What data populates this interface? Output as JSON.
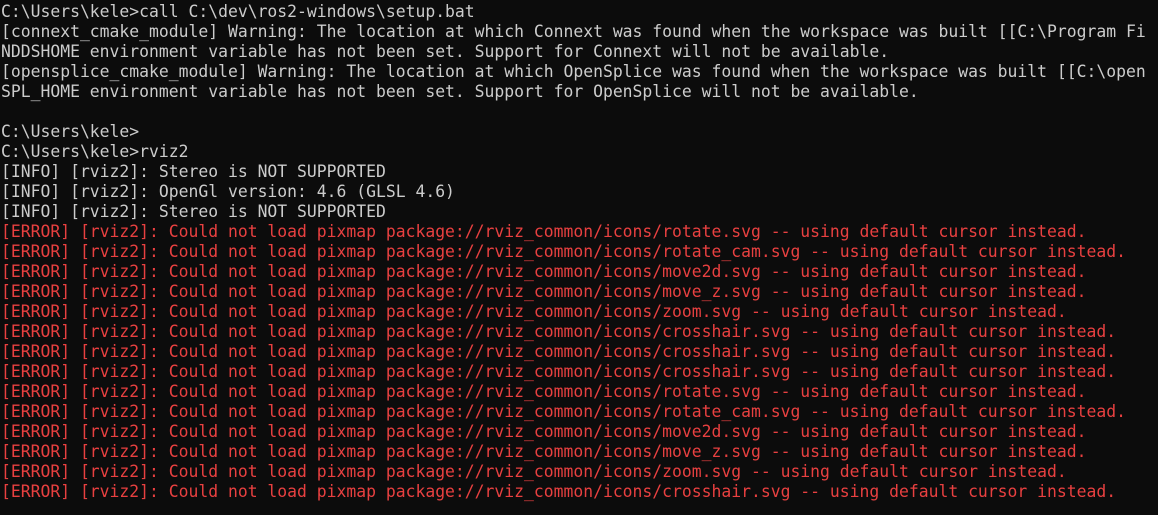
{
  "terminal": {
    "colors": {
      "background": "#0c0c0c",
      "text": "#cccccc",
      "error": "#e84040"
    },
    "lines": [
      {
        "text": "C:\\Users\\kele>call C:\\dev\\ros2-windows\\setup.bat",
        "type": "normal"
      },
      {
        "text": "[connext_cmake_module] Warning: The location at which Connext was found when the workspace was built [[C:\\Program Fi",
        "type": "normal"
      },
      {
        "text": "NDDSHOME environment variable has not been set. Support for Connext will not be available.",
        "type": "normal"
      },
      {
        "text": "[opensplice_cmake_module] Warning: The location at which OpenSplice was found when the workspace was built [[C:\\open",
        "type": "normal"
      },
      {
        "text": "SPL_HOME environment variable has not been set. Support for OpenSplice will not be available.",
        "type": "normal"
      },
      {
        "text": "",
        "type": "blank"
      },
      {
        "text": "C:\\Users\\kele>",
        "type": "normal"
      },
      {
        "text": "C:\\Users\\kele>rviz2",
        "type": "normal"
      },
      {
        "text": "[INFO] [rviz2]: Stereo is NOT SUPPORTED",
        "type": "normal"
      },
      {
        "text": "[INFO] [rviz2]: OpenGl version: 4.6 (GLSL 4.6)",
        "type": "normal"
      },
      {
        "text": "[INFO] [rviz2]: Stereo is NOT SUPPORTED",
        "type": "normal"
      },
      {
        "text": "[ERROR] [rviz2]: Could not load pixmap package://rviz_common/icons/rotate.svg -- using default cursor instead.",
        "type": "error"
      },
      {
        "text": "[ERROR] [rviz2]: Could not load pixmap package://rviz_common/icons/rotate_cam.svg -- using default cursor instead.",
        "type": "error"
      },
      {
        "text": "[ERROR] [rviz2]: Could not load pixmap package://rviz_common/icons/move2d.svg -- using default cursor instead.",
        "type": "error"
      },
      {
        "text": "[ERROR] [rviz2]: Could not load pixmap package://rviz_common/icons/move_z.svg -- using default cursor instead.",
        "type": "error"
      },
      {
        "text": "[ERROR] [rviz2]: Could not load pixmap package://rviz_common/icons/zoom.svg -- using default cursor instead.",
        "type": "error"
      },
      {
        "text": "[ERROR] [rviz2]: Could not load pixmap package://rviz_common/icons/crosshair.svg -- using default cursor instead.",
        "type": "error"
      },
      {
        "text": "[ERROR] [rviz2]: Could not load pixmap package://rviz_common/icons/crosshair.svg -- using default cursor instead.",
        "type": "error"
      },
      {
        "text": "[ERROR] [rviz2]: Could not load pixmap package://rviz_common/icons/crosshair.svg -- using default cursor instead.",
        "type": "error"
      },
      {
        "text": "[ERROR] [rviz2]: Could not load pixmap package://rviz_common/icons/rotate.svg -- using default cursor instead.",
        "type": "error"
      },
      {
        "text": "[ERROR] [rviz2]: Could not load pixmap package://rviz_common/icons/rotate_cam.svg -- using default cursor instead.",
        "type": "error"
      },
      {
        "text": "[ERROR] [rviz2]: Could not load pixmap package://rviz_common/icons/move2d.svg -- using default cursor instead.",
        "type": "error"
      },
      {
        "text": "[ERROR] [rviz2]: Could not load pixmap package://rviz_common/icons/move_z.svg -- using default cursor instead.",
        "type": "error"
      },
      {
        "text": "[ERROR] [rviz2]: Could not load pixmap package://rviz_common/icons/zoom.svg -- using default cursor instead.",
        "type": "error"
      },
      {
        "text": "[ERROR] [rviz2]: Could not load pixmap package://rviz_common/icons/crosshair.svg -- using default cursor instead.",
        "type": "error"
      }
    ]
  }
}
